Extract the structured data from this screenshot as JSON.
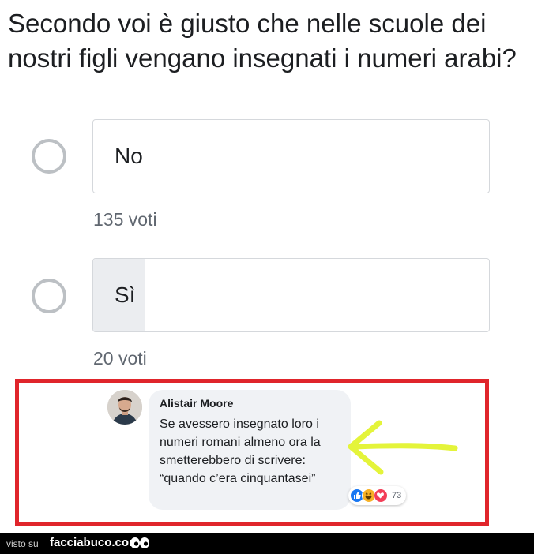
{
  "poll": {
    "question": "Secondo voi è giusto che nelle scuole dei nostri figli vengano insegnati i numeri arabi?",
    "options": [
      {
        "label": "No",
        "votes_text": "135 voti",
        "vote_share": 0.0
      },
      {
        "label": "Sì",
        "votes_text": "20 voti",
        "vote_share": 0.13
      }
    ]
  },
  "comment": {
    "author": "Alistair Moore",
    "text": "Se avessero insegnato loro i numeri romani almeno ora la smetterebbero di scrivere: “quando c’era cinquantasei”",
    "reactions": [
      "like-icon",
      "haha-icon",
      "love-icon"
    ],
    "reaction_count": "73"
  },
  "footer": {
    "prefix": "visto su",
    "brand": "facciabuco.com"
  },
  "colors": {
    "highlight_frame": "#e0252b",
    "arrow": "#e4f43a",
    "like": "#1877f2",
    "haha": "#f7b125",
    "love": "#f33e58",
    "option_fill": "#ebedf0"
  }
}
